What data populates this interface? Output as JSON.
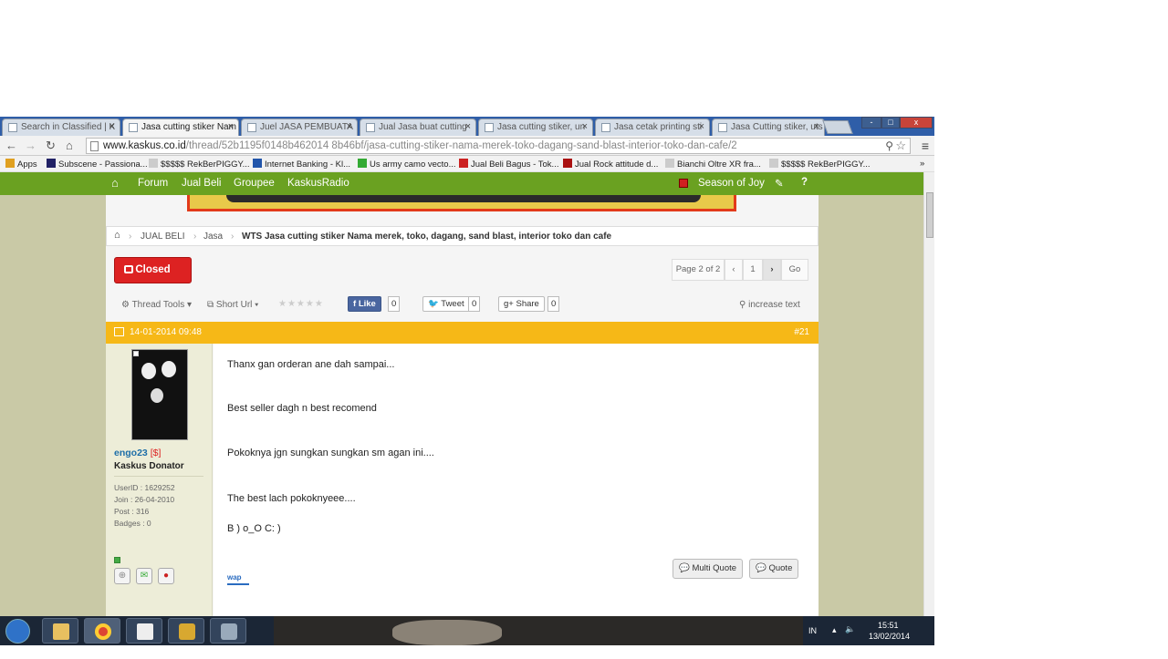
{
  "tabs": [
    {
      "title": "Search in Classified | K",
      "active": false
    },
    {
      "title": "Jasa cutting stiker Nam",
      "active": true
    },
    {
      "title": "Juel JASA PEMBUATA",
      "active": false
    },
    {
      "title": "Jual Jasa buat cutting",
      "active": false
    },
    {
      "title": "Jasa cutting stiker, un",
      "active": false
    },
    {
      "title": "Jasa cetak printing sti",
      "active": false
    },
    {
      "title": "Jasa Cutting stiker, uts",
      "active": false
    }
  ],
  "window": {
    "minimize": "-",
    "maximize": "□",
    "close": "x"
  },
  "omnibox": {
    "host": "www.kaskus.co.id",
    "path": "/thread/52b1195f0148b462014 8b46bf/jasa-cutting-stiker-nama-merek-toko-dagang-sand-blast-interior-toko-dan-cafe/2"
  },
  "bookmarks": [
    {
      "label": "Apps",
      "color": "#e0a020"
    },
    {
      "label": "Subscene - Passiona...",
      "color": "#222266"
    },
    {
      "label": "$$$$$ RekBerPIGGY...",
      "color": "#cccccc"
    },
    {
      "label": "Internet Banking - Kl...",
      "color": "#2255aa"
    },
    {
      "label": "Us army camo vecto...",
      "color": "#33aa33"
    },
    {
      "label": "Jual Beli Bagus - Tok...",
      "color": "#cc2222"
    },
    {
      "label": "Jual Rock attitude d...",
      "color": "#aa1111"
    },
    {
      "label": "Bianchi Oltre XR fra...",
      "color": "#cccccc"
    },
    {
      "label": "$$$$$ RekBerPIGGY...",
      "color": "#cccccc"
    }
  ],
  "bookmarks_more": "»",
  "kaskus_nav": {
    "items": [
      "Forum",
      "Jual Beli",
      "Groupee",
      "KaskusRadio"
    ],
    "season": "Season of Joy"
  },
  "breadcrumb": [
    "JUAL BELI",
    "Jasa",
    "WTS Jasa cutting stiker Nama merek, toko, dagang, sand blast, interior toko dan cafe"
  ],
  "thread": {
    "closed_label": "Closed",
    "pager": {
      "label": "Page 2 of 2",
      "prev": "‹",
      "page1": "1",
      "next": "›",
      "go": "Go"
    },
    "tools": {
      "thread_tools": "Thread Tools",
      "short_url": "Short Url",
      "stars": "★★★★★",
      "like": "Like",
      "like_count": "0",
      "tweet": "Tweet",
      "tweet_count": "0",
      "share": "Share",
      "share_count": "0",
      "increase_text": "increase text"
    }
  },
  "post": {
    "date": "14-01-2014 09:48",
    "number": "#21",
    "user": {
      "name": "engo23",
      "badge": "[$]",
      "rank": "Kaskus Donator",
      "userid": "UserID  : 1629252",
      "join": "Join      : 26-04-2010",
      "post": "Post      : 316",
      "badges": "Badges : 0"
    },
    "lines": [
      "Thanx gan orderan ane dah sampai...",
      "Best seller dagh n best recomend",
      "Pokoknya jgn sungkan sungkan sm agan ini....",
      "The best lach pokoknyeee....",
      "B ) o_O C: )"
    ],
    "multi_quote": "Multi Quote",
    "quote": "Quote",
    "sig": "wap"
  },
  "taskbar": {
    "lang": "IN",
    "time": "15:51",
    "date": "13/02/2014"
  }
}
